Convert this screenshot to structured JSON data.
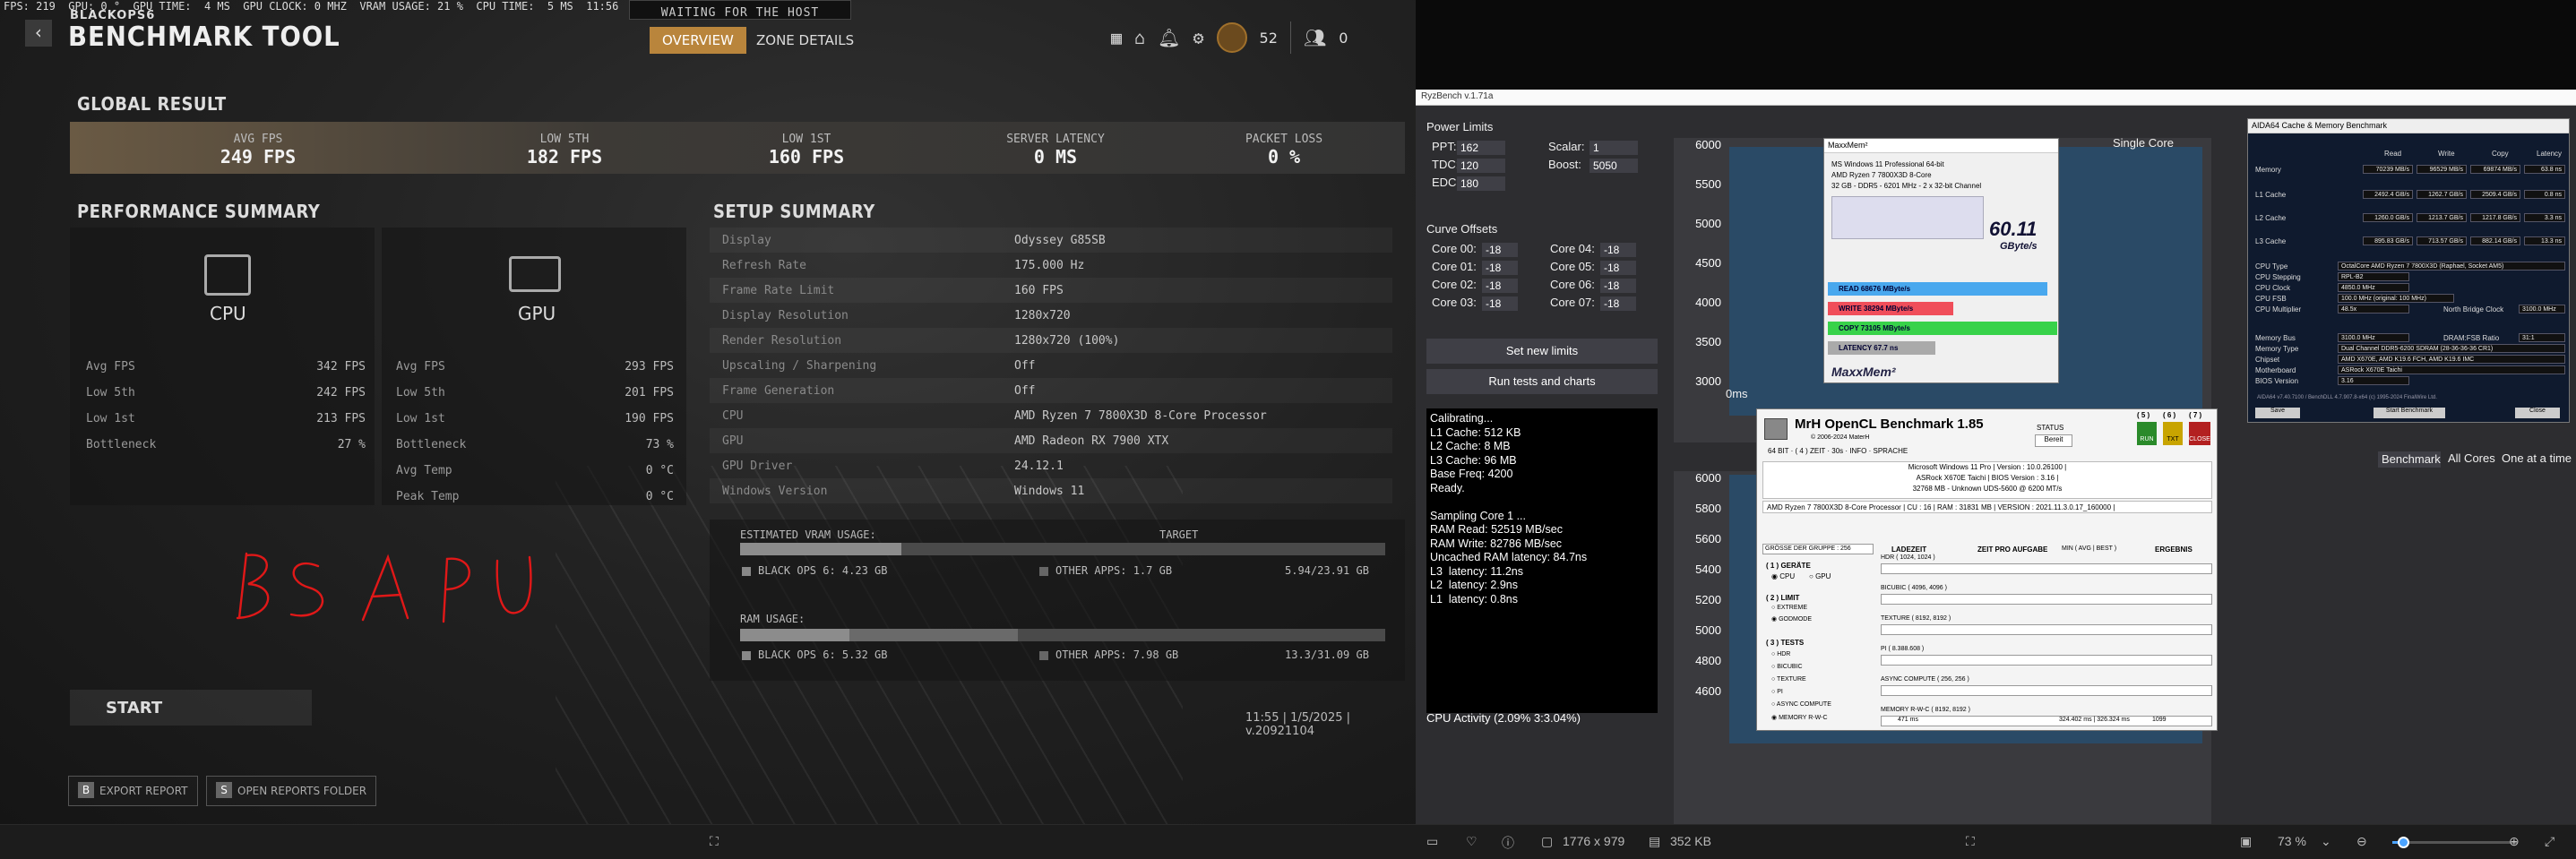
{
  "overlay": {
    "stats": "FPS: 219  GPU: 0 °  GPU TIME:  4 MS  GPU CLOCK: 0 MHZ  VRAM USAGE: 21 %  CPU TIME:  5 MS  11:56"
  },
  "header": {
    "waiting": "WAITING FOR THE HOST",
    "logo": "BLACKOPS6",
    "title": "BENCHMARK TOOL",
    "tabs": [
      "OVERVIEW",
      "ZONE DETAILS"
    ],
    "player_level": "52",
    "party_count": "0"
  },
  "global": {
    "title": "GLOBAL RESULT",
    "stats": [
      {
        "label": "AVG FPS",
        "value": "249 FPS"
      },
      {
        "label": "LOW 5TH",
        "value": "182 FPS"
      },
      {
        "label": "LOW 1ST",
        "value": "160 FPS"
      },
      {
        "label": "SERVER LATENCY",
        "value": "0 MS"
      },
      {
        "label": "PACKET LOSS",
        "value": "0 %"
      }
    ]
  },
  "performance": {
    "title": "PERFORMANCE SUMMARY",
    "cpu_label": "CPU",
    "gpu_label": "GPU",
    "cpu_rows": [
      [
        "Avg FPS",
        "342 FPS"
      ],
      [
        "Low 5th",
        "242 FPS"
      ],
      [
        "Low 1st",
        "213 FPS"
      ],
      [
        "Bottleneck",
        "27 %"
      ]
    ],
    "gpu_rows": [
      [
        "Avg FPS",
        "293 FPS"
      ],
      [
        "Low 5th",
        "201 FPS"
      ],
      [
        "Low 1st",
        "190 FPS"
      ],
      [
        "Bottleneck",
        "73 %"
      ],
      [
        "Avg Temp",
        "0 °C"
      ],
      [
        "Peak Temp",
        "0 °C"
      ]
    ]
  },
  "setup": {
    "title": "SETUP SUMMARY",
    "rows": [
      [
        "Display",
        "Odyssey G85SB"
      ],
      [
        "Refresh Rate",
        "175.000 Hz"
      ],
      [
        "Frame Rate Limit",
        "160 FPS"
      ],
      [
        "Display Resolution",
        "1280x720"
      ],
      [
        "Render Resolution",
        "1280x720 (100%)"
      ],
      [
        "Upscaling / Sharpening",
        "Off"
      ],
      [
        "Frame Generation",
        "Off"
      ],
      [
        "CPU",
        "AMD Ryzen 7 7800X3D 8-Core Processor"
      ],
      [
        "GPU",
        "AMD Radeon RX 7900 XTX"
      ],
      [
        "GPU Driver",
        "24.12.1"
      ],
      [
        "Windows Version",
        "Windows 11"
      ]
    ],
    "vram": {
      "label": "ESTIMATED VRAM USAGE:",
      "target": "TARGET",
      "bo6": "BLACK OPS 6: 4.23 GB",
      "other": "OTHER APPS: 1.7 GB",
      "total": "5.94/23.91 GB",
      "fill": 0.25
    },
    "ram": {
      "label": "RAM USAGE:",
      "bo6": "BLACK OPS 6: 5.32 GB",
      "other": "OTHER APPS: 7.98 GB",
      "total": "13.3/31.09 GB",
      "fill": 0.17,
      "other_fill": 0.26
    }
  },
  "annotation": "BS APU",
  "start_label": "START",
  "footer": {
    "export": "EXPORT REPORT",
    "export_key": "B",
    "open": "OPEN REPORTS FOLDER",
    "open_key": "S",
    "version": "11:55 | 1/5/2025 | v.20921104"
  },
  "ryzen": {
    "title": "RyzBench v.1.71a",
    "power_title": "Power Limits",
    "ppt_label": "PPT:",
    "ppt": "162",
    "tdc_label": "TDC:",
    "tdc": "120",
    "edc_label": "EDC:",
    "edc": "180",
    "scalar_label": "Scalar:",
    "scalar": "1",
    "boost_label": "Boost:",
    "boost": "5050",
    "curve_title": "Curve Offsets",
    "cores": [
      [
        "Core 00:",
        "-18"
      ],
      [
        "Core 01:",
        "-18"
      ],
      [
        "Core 02:",
        "-18"
      ],
      [
        "Core 03:",
        "-18"
      ],
      [
        "Core 04:",
        "-18"
      ],
      [
        "Core 05:",
        "-18"
      ],
      [
        "Core 06:",
        "-18"
      ],
      [
        "Core 07:",
        "-18"
      ]
    ],
    "btn_limits": "Set new limits",
    "btn_run": "Run tests and charts",
    "console": "Calibrating...\nL1 Cache: 512 KB\nL2 Cache: 8 MB\nL3 Cache: 96 MB\nBase Freq: 4200\nReady.\n\nSampling Core 1 ...\nRAM Read: 52519 MB/sec\nRAM Write: 82786 MB/sec\nUncached RAM latency: 84.7ns\nL3  latency: 11.2ns\nL2  latency: 2.9ns\nL1  latency: 0.8ns",
    "cpu_activity": "CPU Activity (2.09% 3:3.04%)",
    "chart_title": "Single Core",
    "yticks_top": [
      "6000",
      "5500",
      "5000",
      "4500",
      "4000",
      "3500",
      "3000"
    ],
    "x_label": "0ms",
    "yticks_bottom": [
      "6000",
      "5800",
      "5600",
      "5400",
      "5200",
      "5000",
      "4800",
      "4600"
    ],
    "benchmark_btn": "Benchmark",
    "all_cores": "All Cores",
    "one_at_time": "One at a time"
  },
  "maxxmem": {
    "title": "MaxxMem²",
    "os": "MS Windows 11 Professional 64-bit",
    "cpu": "AMD Ryzen 7 7800X3D 8-Core",
    "memory": "32 GB - DDR5 - 6201 MHz - 2 x 32-bit Channel",
    "score": "60.11",
    "unit": "GByte/s",
    "read": "READ  68676  MByte/s",
    "write": "WRITE  38294  MByte/s",
    "copy": "COPY  73105  MByte/s",
    "latency": "LATENCY  67.7  ns",
    "brand": "MaxxMem²"
  },
  "aida": {
    "title": "AIDA64 Cache & Memory Benchmark",
    "cols": [
      "Read",
      "Write",
      "Copy",
      "Latency"
    ],
    "rows": [
      [
        "Memory",
        "70239 MB/s",
        "96529 MB/s",
        "69874 MB/s",
        "63.8 ns"
      ],
      [
        "L1 Cache",
        "2492.4 GB/s",
        "1262.7 GB/s",
        "2509.4 GB/s",
        "0.8 ns"
      ],
      [
        "L2 Cache",
        "1260.0 GB/s",
        "1213.7 GB/s",
        "1217.8 GB/s",
        "3.3 ns"
      ],
      [
        "L3 Cache",
        "895.83 GB/s",
        "713.57 GB/s",
        "882.14 GB/s",
        "13.3 ns"
      ]
    ],
    "info": [
      [
        "CPU Type",
        "OctalCore AMD Ryzen 7 7800X3D (Raphael, Socket AM5)"
      ],
      [
        "CPU Stepping",
        "RPL-B2"
      ],
      [
        "CPU Clock",
        "4850.0 MHz"
      ],
      [
        "CPU FSB",
        "100.0 MHz (original: 100 MHz)"
      ],
      [
        "CPU Multiplier",
        "48.5x"
      ],
      [
        "Memory Bus",
        "3100.0 MHz"
      ],
      [
        "Memory Type",
        "Dual Channel DDR5-6200 SDRAM (28-36-36-36 CR1)"
      ],
      [
        "Chipset",
        "AMD X670E, AMD K19.6 FCH, AMD K19.6 IMC"
      ],
      [
        "Motherboard",
        "ASRock X670E Taichi"
      ],
      [
        "BIOS Version",
        "3.16"
      ]
    ],
    "nb_clock_label": "North Bridge Clock",
    "nb_clock": "3100.0 MHz",
    "dram_ratio_label": "DRAM:FSB Ratio",
    "dram_ratio": "31:1",
    "footer": "AIDA64 v7.40.7100 / BenchDLL 4.7.907.8-x64  (c) 1995-2024 FinalWire Ltd.",
    "save": "Save",
    "start": "Start Benchmark",
    "close": "Close"
  },
  "mrh": {
    "title": "MrH OpenCL Benchmark 1.85",
    "subtitle": "© 2006-2024 MaterH",
    "menu": "64 BIT  ·  ( 4 ) ZEIT  ·  30s  ·  INFO  ·  SPRACHE",
    "status_label": "STATUS",
    "status": "Bereit",
    "os": "Microsoft Windows 11 Pro | Version : 10.0.26100 |",
    "board": "ASRock X670E Taichi | BIOS Version : 3.16 |",
    "ram": "32768 MB - Unknown UDS-5600                @ 6200 MT/s",
    "cpu": "AMD Ryzen 7 7800X3D 8-Core Processor",
    "cpu_info": "| CU : 16 | RAM : 31831 MB | VERSION : 2021.11.3.0.17_160000 |",
    "group": "GRÖSSE DER GRUPPE : 256",
    "col_headers": [
      "LADEZEIT",
      "ZEIT PRO AUFGABE",
      "MIN ( AVG | BEST )",
      "ERGEBNIS"
    ],
    "device_label": "( 1 ) GERÄTE",
    "cpu_opt": "CPU",
    "gpu_opt": "GPU",
    "limit_label": "( 2 ) LIMIT",
    "extreme": "EXTREME",
    "godmode": "GODMODE",
    "tests_label": "( 3 ) TESTS",
    "tests": [
      "HDR",
      "BICUBIC",
      "TEXTURE",
      "PI",
      "ASYNC COMPUTE",
      "MEMORY R-W-C"
    ],
    "test_rows": [
      "HDR ( 1024, 1024 )",
      "BICUBIC ( 4096, 4096 )",
      "TEXTURE ( 8192, 8192 )",
      "PI ( 8.388.608 )",
      "ASYNC COMPUTE ( 256, 256 )",
      "MEMORY R-W-C ( 8192, 8192 )"
    ],
    "mem_result": [
      "471 ms",
      "324.402 ms | 326.324 ms",
      "1099"
    ],
    "buttons": [
      [
        "( 5 )",
        "RUN"
      ],
      [
        "( 6 )",
        "TXT"
      ],
      [
        "( 7 )",
        "CLOSE"
      ]
    ]
  },
  "taskbar": {
    "dims": "1776 x 979",
    "size": "352 KB",
    "zoom": "73 %"
  }
}
